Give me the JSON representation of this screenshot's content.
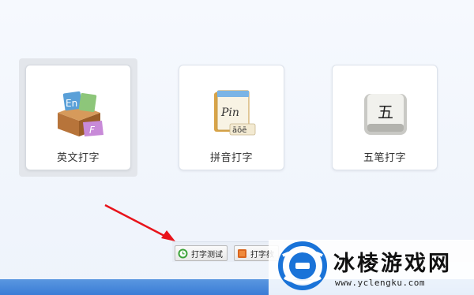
{
  "modes": [
    {
      "label": "英文打字",
      "icon": "english-box-icon",
      "selected": true
    },
    {
      "label": "拼音打字",
      "icon": "pinyin-book-icon",
      "selected": false
    },
    {
      "label": "五笔打字",
      "icon": "wubi-key-icon",
      "key_char": "五",
      "selected": false
    }
  ],
  "pinyin_icon": {
    "word": "Pin",
    "tones": "āōē"
  },
  "english_icon": {
    "letters": "En",
    "letter_f": "F"
  },
  "toolbar": {
    "typing_test_label": "打字测试",
    "typing_tutorial_label": "打字教"
  },
  "watermark": {
    "name": "冰棱游戏网",
    "url": "www.yclengku.com"
  },
  "colors": {
    "arrow": "#e8131b",
    "accent_blue": "#3a7cd6",
    "watermark_blue": "#1a73d8"
  }
}
